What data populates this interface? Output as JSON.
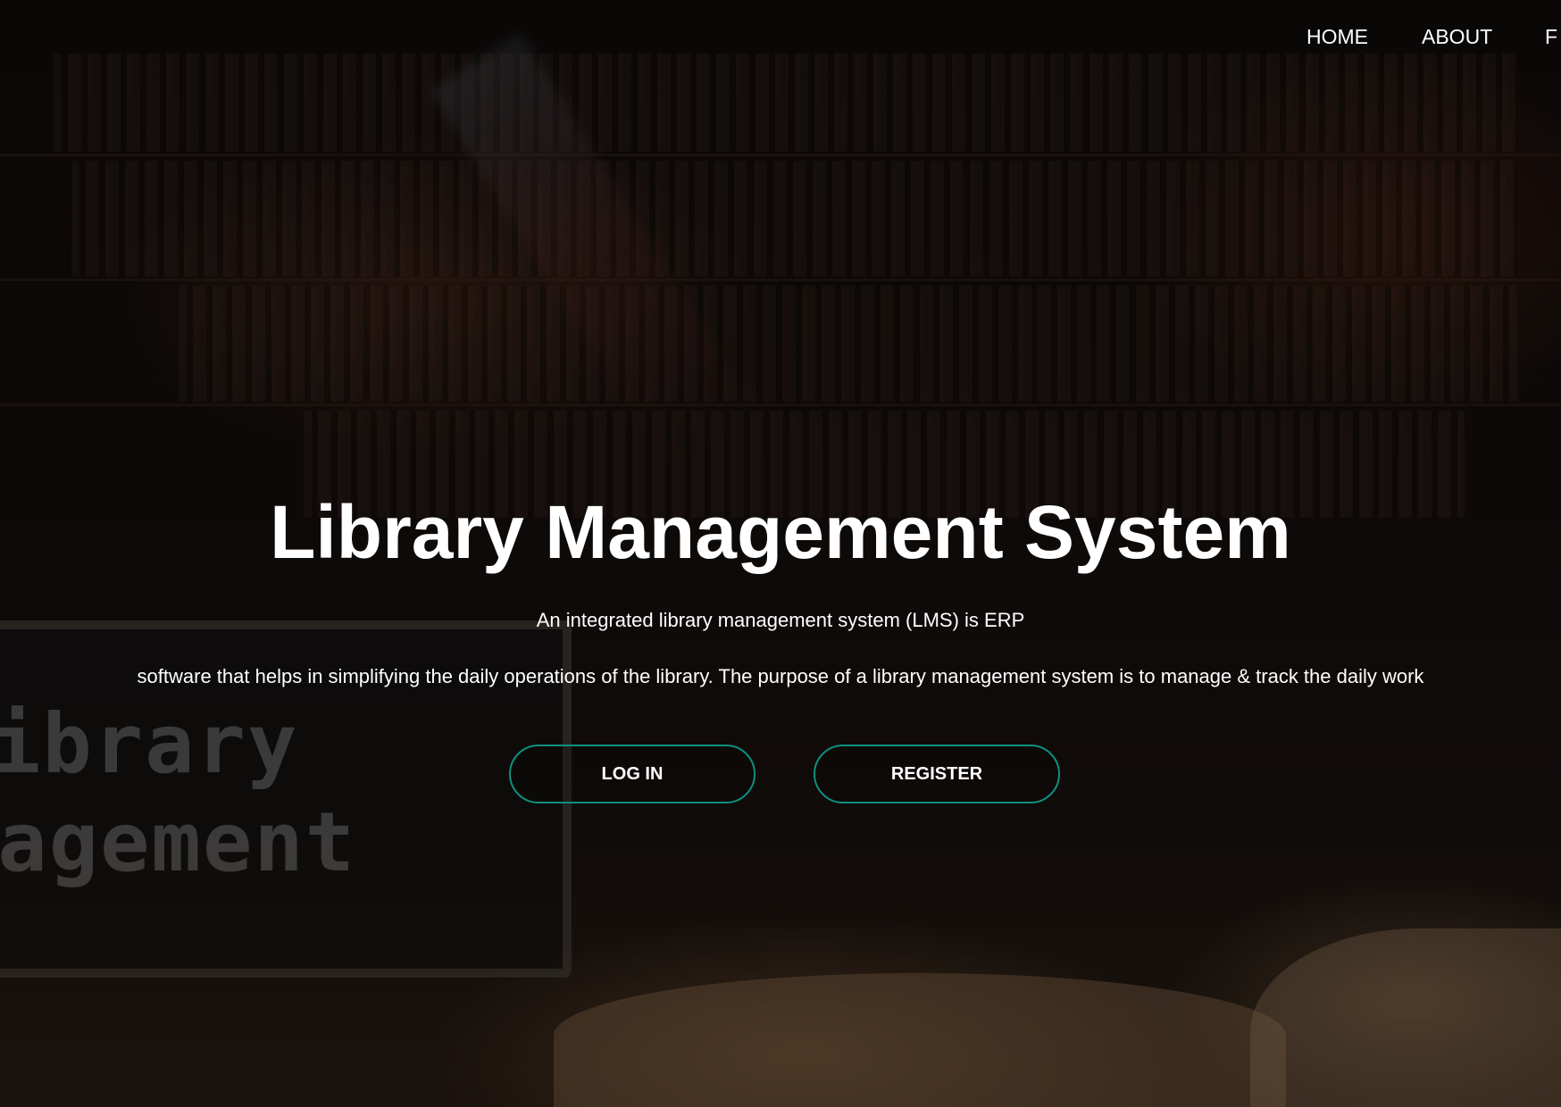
{
  "nav": {
    "items": [
      {
        "label": "HOME"
      },
      {
        "label": "ABOUT"
      },
      {
        "label": "F"
      }
    ]
  },
  "hero": {
    "title": "Library Management System",
    "subtitle_line1": "An integrated library management system (LMS) is ERP",
    "subtitle_line2": "software that helps in simplifying the daily operations of the library. The purpose of a library management system is to manage & track the daily work"
  },
  "buttons": {
    "login": "LOG IN",
    "register": "REGISTER"
  },
  "background": {
    "laptop_text_line1": "ibrary",
    "laptop_text_line2": "nagement"
  },
  "colors": {
    "button_border": "#0f8f7f",
    "text": "#ffffff"
  }
}
